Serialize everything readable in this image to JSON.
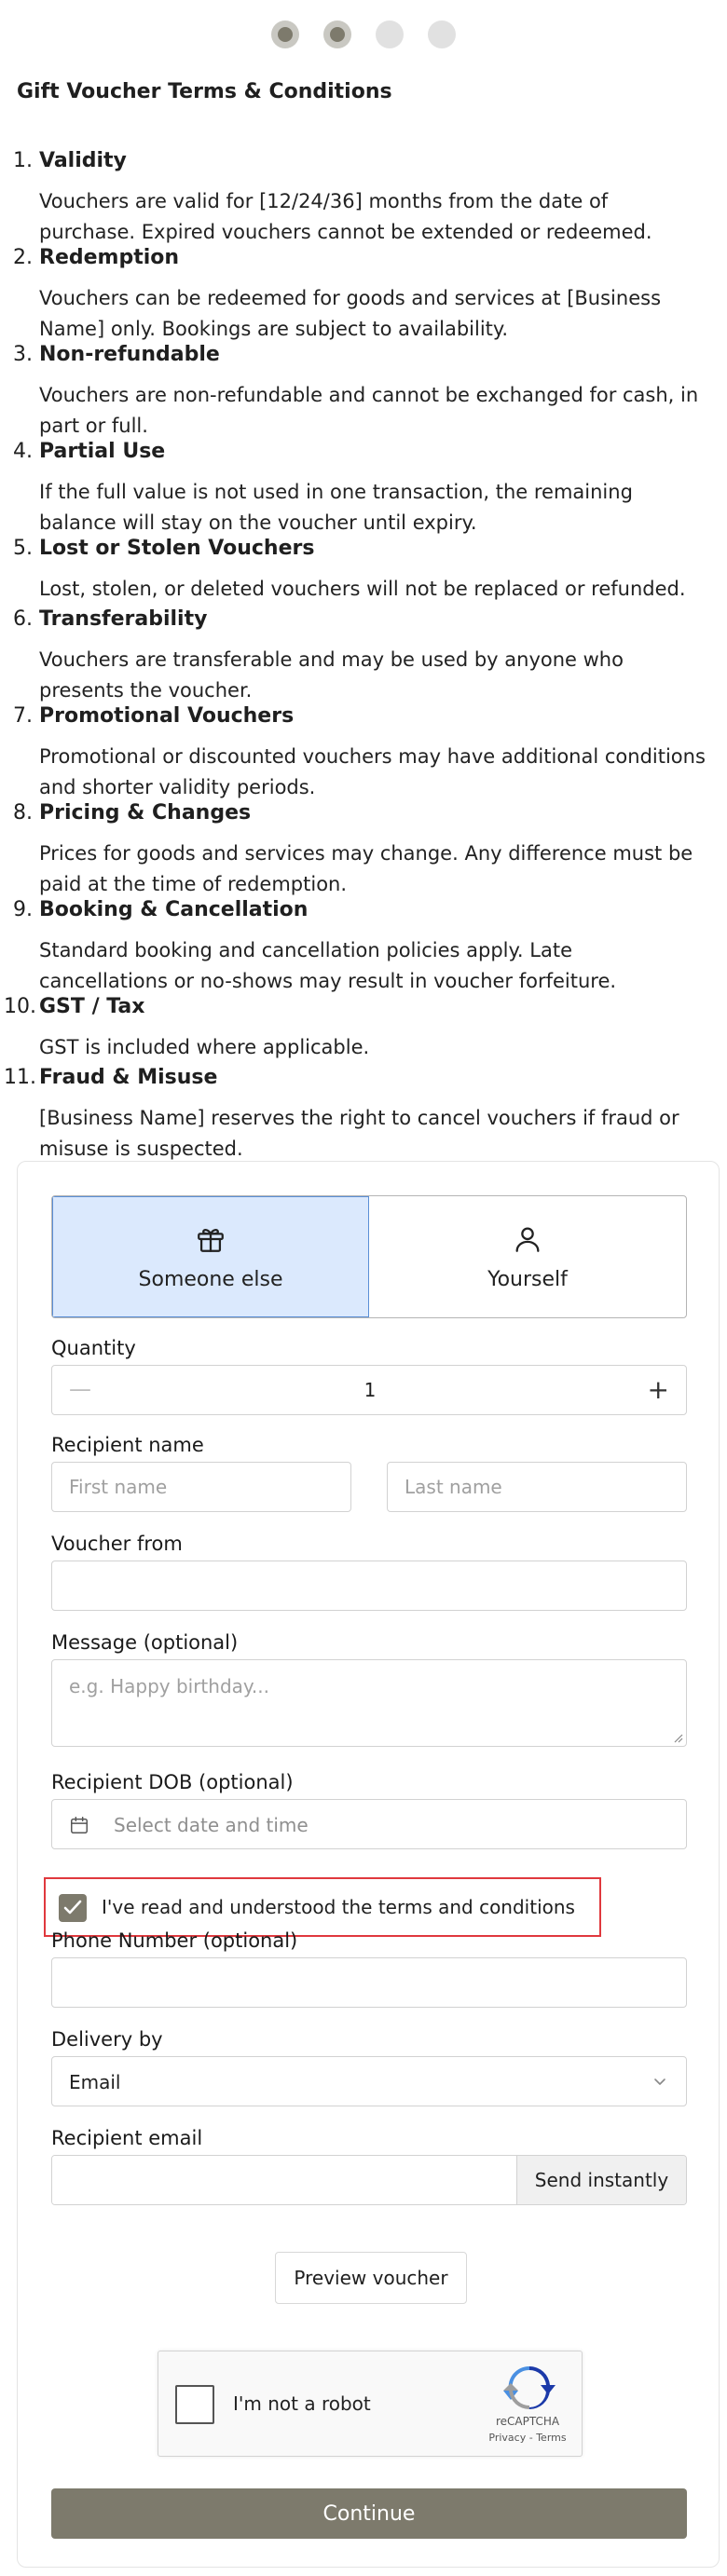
{
  "terms": {
    "title": "Gift Voucher Terms & Conditions",
    "items": [
      {
        "num": "1.",
        "heading": "Validity",
        "body": "Vouchers are valid for [12/24/36] months from the date of purchase. Expired vouchers cannot be extended or redeemed."
      },
      {
        "num": "2.",
        "heading": "Redemption",
        "body": "Vouchers can be redeemed for goods and services at [Business Name] only. Bookings are subject to availability."
      },
      {
        "num": "3.",
        "heading": "Non-refundable",
        "body": "Vouchers are non-refundable and cannot be exchanged for cash, in part or full."
      },
      {
        "num": "4.",
        "heading": "Partial Use",
        "body": "If the full value is not used in one transaction, the remaining balance will stay on the voucher until expiry."
      },
      {
        "num": "5.",
        "heading": "Lost or Stolen Vouchers",
        "body": "Lost, stolen, or deleted vouchers will not be replaced or refunded."
      },
      {
        "num": "6.",
        "heading": "Transferability",
        "body": "Vouchers are transferable and may be used by anyone who presents the voucher."
      },
      {
        "num": "7.",
        "heading": "Promotional Vouchers",
        "body": "Promotional or discounted vouchers may have additional conditions and shorter validity periods."
      },
      {
        "num": "8.",
        "heading": "Pricing & Changes",
        "body": "Prices for goods and services may change. Any difference must be paid at the time of redemption."
      },
      {
        "num": "9.",
        "heading": "Booking & Cancellation",
        "body": "Standard booking and cancellation policies apply. Late cancellations or no-shows may result in voucher forfeiture."
      },
      {
        "num": "10.",
        "heading": "GST / Tax",
        "body": "GST is included where applicable."
      },
      {
        "num": "11.",
        "heading": "Fraud & Misuse",
        "body": "[Business Name] reserves the right to cancel vouchers if fraud or misuse is suspected."
      }
    ]
  },
  "form": {
    "tabs": [
      {
        "label": "Someone else",
        "icon": "gift-icon",
        "active": true
      },
      {
        "label": "Yourself",
        "icon": "user-icon",
        "active": false
      }
    ],
    "quantity": {
      "label": "Quantity",
      "value": "1",
      "minus": "—",
      "plus": "+"
    },
    "recipient_name": {
      "label": "Recipient name",
      "first_placeholder": "First name",
      "last_placeholder": "Last name"
    },
    "voucher_from": {
      "label": "Voucher from",
      "value": ""
    },
    "message": {
      "label": "Message (optional)",
      "placeholder": "e.g. Happy birthday..."
    },
    "dob": {
      "label": "Recipient DOB (optional)",
      "placeholder": "Select date and time"
    },
    "consent": {
      "label": "I've read and understood the terms and conditions",
      "checked": true
    },
    "phone": {
      "label": "Phone Number (optional)",
      "value": ""
    },
    "delivery": {
      "label": "Delivery by",
      "value": "Email"
    },
    "recipient_email": {
      "label": "Recipient email",
      "value": "",
      "send_label": "Send instantly"
    },
    "preview_label": "Preview voucher",
    "captcha": {
      "label": "I'm not a robot",
      "brand": "reCAPTCHA",
      "links": "Privacy - Terms"
    },
    "continue_label": "Continue"
  },
  "colors": {
    "accent": "#7d7a6c",
    "tab_active_bg": "#dbe9fd",
    "highlight_border": "#e0393e"
  }
}
